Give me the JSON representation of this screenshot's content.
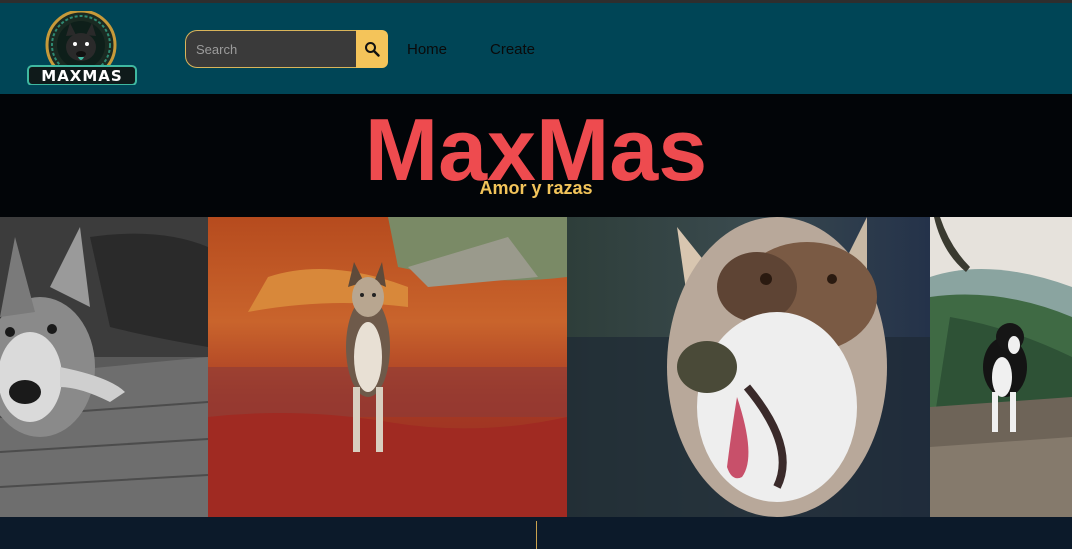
{
  "header": {
    "logo_text": "MAXMAS",
    "search": {
      "placeholder": "Search",
      "value": ""
    },
    "nav": {
      "home": "Home",
      "create": "Create"
    }
  },
  "hero": {
    "title": "MaxMas",
    "subtitle": "Amor y razas"
  },
  "colors": {
    "navbar": "#004556",
    "hero_background": "#020508",
    "title": "#ee4b4f",
    "subtitle": "#f2c45a",
    "search_button": "#f4c45a",
    "footer": "#0c1a2a"
  },
  "icons": {
    "search_button": "magnifier-icon",
    "logo": "dog-logo-icon"
  }
}
